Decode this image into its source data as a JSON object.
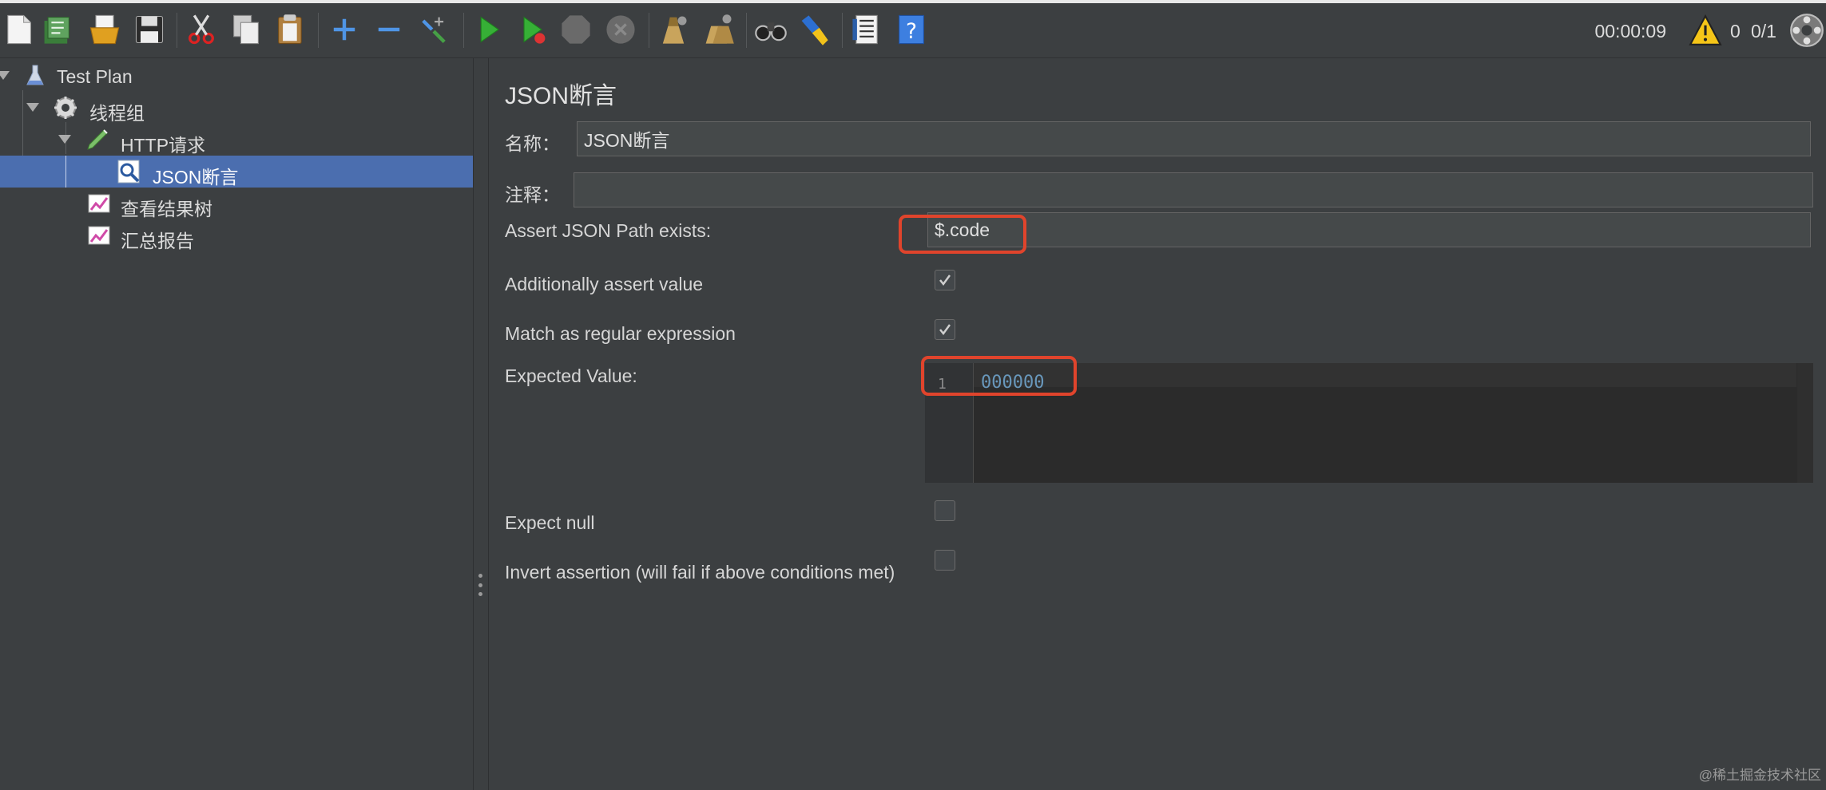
{
  "toolbar": {
    "buttons": [
      "new-icon",
      "templates-icon",
      "open-icon",
      "save-icon",
      "cut-icon",
      "copy-icon",
      "paste-icon",
      "expand-icon",
      "collapse-icon",
      "toggle-icon",
      "start-icon",
      "start-no-pause-icon",
      "stop-icon",
      "shutdown-icon",
      "clear-icon",
      "clear-all-icon",
      "search-icon",
      "reset-search-icon",
      "function-helper-icon",
      "help-icon"
    ],
    "timer": "00:00:09",
    "warning_count": "0",
    "threads": "0/1"
  },
  "tree": {
    "items": [
      {
        "label": "Test Plan",
        "icon": "test-plan-icon"
      },
      {
        "label": "线程组",
        "icon": "thread-group-icon"
      },
      {
        "label": "HTTP请求",
        "icon": "http-sampler-icon"
      },
      {
        "label": "JSON断言",
        "icon": "assertion-icon"
      },
      {
        "label": "查看结果树",
        "icon": "listener-icon"
      },
      {
        "label": "汇总报告",
        "icon": "listener-icon"
      }
    ]
  },
  "panel": {
    "title": "JSON断言",
    "name_label": "名称：",
    "name_value": "JSON断言",
    "comment_label": "注释：",
    "comment_value": "",
    "path_label": "Assert JSON Path exists:",
    "path_value": "$.code",
    "assert_value_label": "Additionally assert value",
    "assert_value_checked": true,
    "regex_label": "Match as regular expression",
    "regex_checked": true,
    "expected_label": "Expected Value:",
    "expected_line_number": "1",
    "expected_value": "000000",
    "expect_null_label": "Expect null",
    "expect_null_checked": false,
    "invert_label": "Invert assertion (will fail if above conditions met)",
    "invert_checked": false
  },
  "watermark": "@稀土掘金技术社区",
  "colors": {
    "background": "#3c3f41",
    "selection": "#4b6eaf",
    "highlight_box": "#e0442c",
    "code_number": "#6897bb"
  }
}
